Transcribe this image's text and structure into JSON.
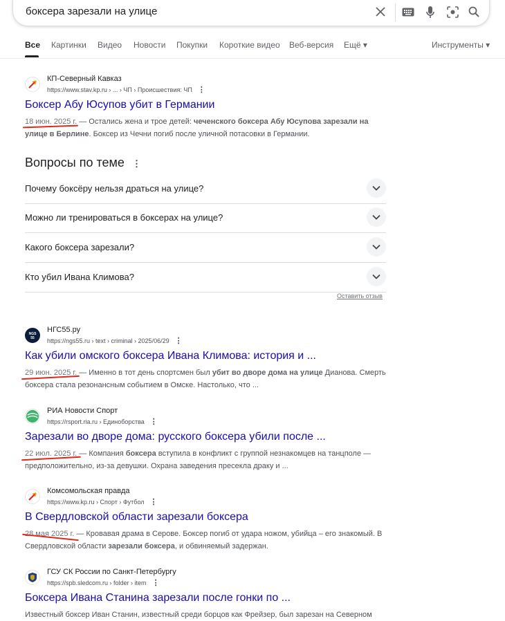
{
  "search": {
    "query": "боксера зарезали на улице"
  },
  "tabs": [
    "Все",
    "Картинки",
    "Видео",
    "Новости",
    "Покупки",
    "Короткие видео",
    "Веб-версия",
    "Ещё ▾"
  ],
  "tools_label": "Инструменты ▾",
  "results_top": [
    {
      "site": "КП-Северный Кавказ",
      "url": "https://www.stav.kp.ru › ... › ЧП › Происшествия: ЧП",
      "title": "Боксер Абу Юсупов убит в Германии",
      "date": "18 июн. 2025 г.",
      "sep": " — ",
      "s1": "Остались жена и трое детей: ",
      "b1": "чеченского боксера Абу Юсупова зарезали на улице в Берлине",
      "s2": ". Боксер из Чечни погиб после уличной потасовки в Германии.",
      "favicon": "kp-icon"
    }
  ],
  "paa": {
    "title": "Вопросы по теме",
    "questions": [
      "Почему боксёру нельзя драться на улице?",
      "Можно ли тренироваться в боксерах на улице?",
      "Какого боксера зарезали?",
      "Кто убил Ивана Климова?"
    ],
    "feedback": "Оставить отзыв"
  },
  "results": [
    {
      "site": "НГС55.ру",
      "url": "https://ngs55.ru › text › criminal › 2025/06/29",
      "title": "Как убили омского боксера Ивана Климова: история и ...",
      "date": "29 июн. 2025 г.",
      "sep": " — ",
      "s1": "Именно в тот день спортсмен был ",
      "b1": "убит во дворе дома на улице",
      "s2": " Дианова. Смерть боксера стала резонансным событием в Омске. Настолько, что ...",
      "favicon": "ngs-icon"
    },
    {
      "site": "РИА Новости Спорт",
      "url": "https://rsport.ria.ru › Единоборства",
      "title": "Зарезали во дворе дома: русского боксера убили после ...",
      "date": "22 июл. 2025 г.",
      "sep": " — ",
      "s1": "Компания ",
      "b1": "боксера",
      "s2": " вступила в конфликт с группой незнакомцев на танцполе — предположительно, из-за девушки. Охрана заведения пресекла драку и ...",
      "favicon": "ria-icon"
    },
    {
      "site": "Комсомольская правда",
      "url": "https://www.kp.ru › Спорт › Футбол",
      "title": "В Свердловской области зарезали боксера",
      "date": "28 мая 2025 г.",
      "sep": " — ",
      "s1": "Кровавая драма в Серове. Боксер погиб от удара ножом, убийца – его знакомый. В Свердловской области ",
      "b1": "зарезали боксера",
      "s2": ", и обвиняемый задержан.",
      "favicon": "kp-icon"
    },
    {
      "site": "ГСУ СК России по Санкт-Петербургу",
      "url": "https://spb.sledcom.ru › folder › item",
      "title": "Боксера Ивана Станина зарезали после гонки по ...",
      "date": "",
      "sep": "",
      "s1": "Известный боксер Иван Станин, известный среди борцов как Фрейзер, был зарезан на Северном",
      "b1": "",
      "s2": "",
      "favicon": "sk-icon"
    }
  ]
}
